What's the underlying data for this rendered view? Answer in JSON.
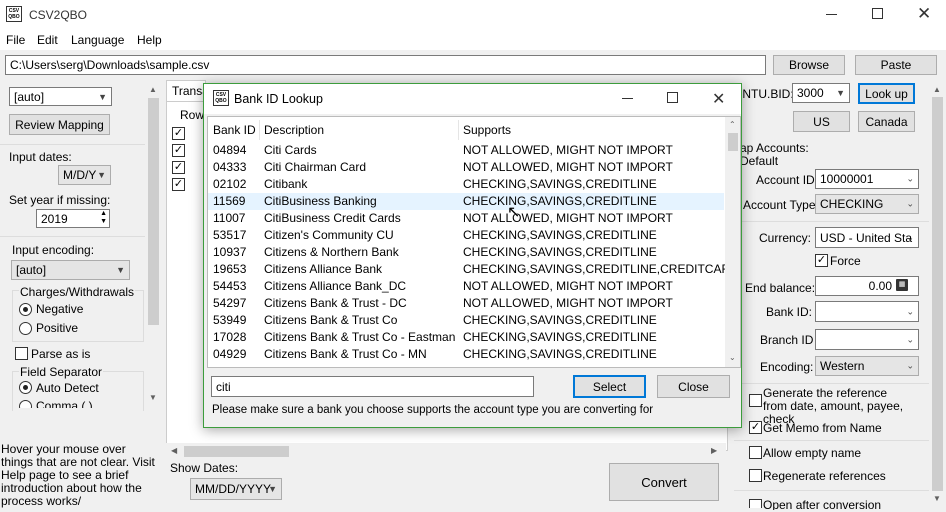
{
  "app": {
    "title": "CSV2QBO",
    "icon_text": "CSV QBO"
  },
  "menu": [
    "File",
    "Edit",
    "Language",
    "Help"
  ],
  "file_path": "C:\\Users\\serg\\Downloads\\sample.csv",
  "buttons": {
    "browse": "Browse",
    "paste": "Paste",
    "lookup": "Look up",
    "us": "US",
    "canada": "Canada",
    "review_mapping": "Review Mapping",
    "convert": "Convert"
  },
  "left": {
    "auto_combo": "[auto]",
    "input_dates_label": "Input dates:",
    "input_dates_value": "M/D/Y",
    "set_year_label": "Set year if missing:",
    "year_value": "2019",
    "input_encoding_label": "Input encoding:",
    "encoding_value": "[auto]",
    "charges_group": "Charges/Withdrawals",
    "negative": "Negative",
    "positive": "Positive",
    "parse_as_is": "Parse as is",
    "field_separator": "Field Separator",
    "auto_detect": "Auto Detect",
    "comma": "Comma (,)",
    "help_text": "Hover your mouse over things that are not clear. Visit Help page to see a brief introduction about how the process works/"
  },
  "middle": {
    "tab": "Transa",
    "row_label": "Row",
    "show_dates_label": "Show Dates:",
    "show_dates_value": "MM/DD/YYYY"
  },
  "right": {
    "intu_bid_label": "INTU.BID:",
    "intu_bid_value": "3000",
    "map_accounts": "ap Accounts:",
    "default": "Default",
    "account_id_label": "Account ID:",
    "account_id_value": "10000001",
    "account_type_label": "Account Type:",
    "account_type_value": "CHECKING",
    "currency_label": "Currency:",
    "currency_value": "USD - United Sta",
    "force": "Force",
    "end_balance_label": "End balance:",
    "end_balance_value": "0.00",
    "bank_id_label": "Bank ID:",
    "branch_id_label": "Branch ID",
    "encoding_label": "Encoding:",
    "encoding_value": "Western",
    "generate_ref": "Generate the reference from date, amount, payee, check",
    "get_memo": "Get Memo from Name",
    "allow_empty": "Allow empty name",
    "regenerate": "Regenerate references",
    "open_after": "Open after conversion"
  },
  "dialog": {
    "title": "Bank ID Lookup",
    "columns": [
      "Bank ID",
      "Description",
      "Supports"
    ],
    "rows": [
      [
        "04894",
        "Citi Cards",
        "NOT ALLOWED, MIGHT NOT IMPORT"
      ],
      [
        "04333",
        "Citi Chairman Card",
        "NOT ALLOWED, MIGHT NOT IMPORT"
      ],
      [
        "02102",
        "Citibank",
        "CHECKING,SAVINGS,CREDITLINE"
      ],
      [
        "11569",
        "CitiBusiness Banking",
        "CHECKING,SAVINGS,CREDITLINE"
      ],
      [
        "11007",
        "CitiBusiness Credit Cards",
        "NOT ALLOWED, MIGHT NOT IMPORT"
      ],
      [
        "53517",
        "Citizen's Community CU",
        "CHECKING,SAVINGS,CREDITLINE"
      ],
      [
        "10937",
        "Citizens & Northern Bank",
        "CHECKING,SAVINGS,CREDITLINE"
      ],
      [
        "19653",
        "Citizens Alliance Bank",
        "CHECKING,SAVINGS,CREDITLINE,CREDITCARD"
      ],
      [
        "54453",
        "Citizens Alliance Bank_DC",
        "NOT ALLOWED, MIGHT NOT IMPORT"
      ],
      [
        "54297",
        "Citizens Bank & Trust - DC",
        "NOT ALLOWED, MIGHT NOT IMPORT"
      ],
      [
        "53949",
        "Citizens Bank & Trust Co",
        "CHECKING,SAVINGS,CREDITLINE"
      ],
      [
        "17028",
        "Citizens Bank & Trust Co - Eastman",
        "CHECKING,SAVINGS,CREDITLINE"
      ],
      [
        "04929",
        "Citizens Bank & Trust Co - MN",
        "CHECKING,SAVINGS,CREDITLINE"
      ]
    ],
    "search_value": "citi",
    "select": "Select",
    "close": "Close",
    "note": "Please make sure a bank you choose supports the account type you are converting for"
  }
}
